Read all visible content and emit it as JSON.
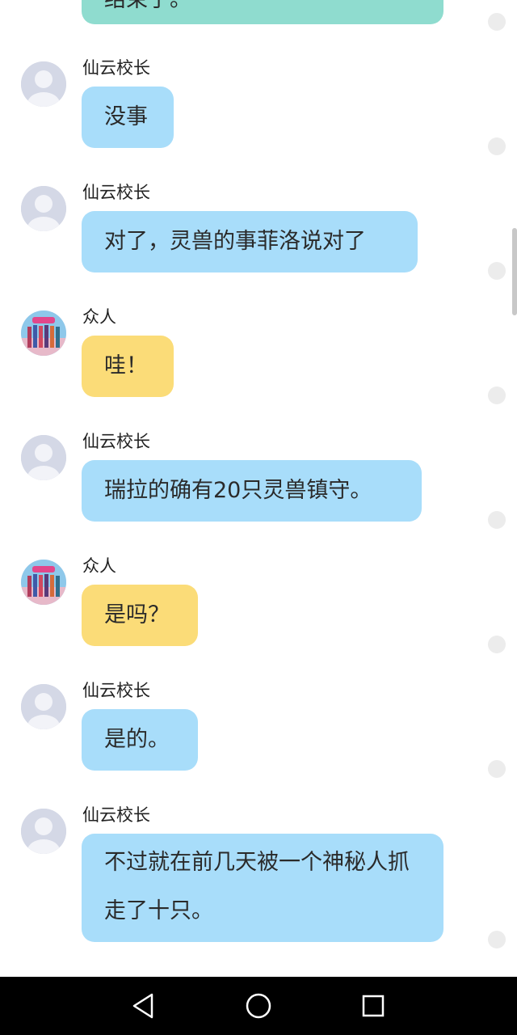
{
  "colors": {
    "blue_bubble": "#a8ddfa",
    "yellow_bubble": "#fbdc78",
    "green_bubble": "#8fdccf",
    "navbar": "#000000"
  },
  "messages": [
    {
      "sender": "",
      "text": "结束了。",
      "bubble_color": "green",
      "avatar": "none",
      "partial": true
    },
    {
      "sender": "仙云校长",
      "text": "没事",
      "bubble_color": "blue",
      "avatar": "default-avatar"
    },
    {
      "sender": "仙云校长",
      "text": "对了，灵兽的事菲洛说对了",
      "bubble_color": "blue",
      "avatar": "default-avatar"
    },
    {
      "sender": "众人",
      "text": "哇！",
      "bubble_color": "yellow",
      "avatar": "group-photo-avatar"
    },
    {
      "sender": "仙云校长",
      "text": "瑞拉的确有20只灵兽镇守。",
      "bubble_color": "blue",
      "avatar": "default-avatar"
    },
    {
      "sender": "众人",
      "text": "是吗？",
      "bubble_color": "yellow",
      "avatar": "group-photo-avatar"
    },
    {
      "sender": "仙云校长",
      "text": "是的。",
      "bubble_color": "blue",
      "avatar": "default-avatar"
    },
    {
      "sender": "仙云校长",
      "text": "不过就在前几天被一个神秘人抓走了十只。",
      "bubble_color": "blue",
      "avatar": "default-avatar"
    }
  ],
  "navbar": {
    "back_icon": "triangle-back-icon",
    "home_icon": "circle-home-icon",
    "recents_icon": "square-recents-icon"
  }
}
